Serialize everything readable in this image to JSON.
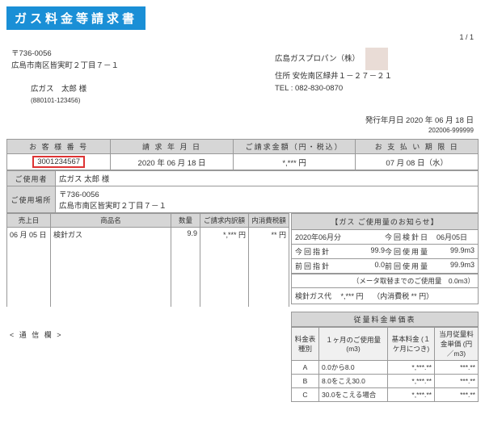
{
  "title": "ガス料金等請求書",
  "page": "1 / 1",
  "postal": "〒736-0056",
  "address": "広島市南区皆実町２丁目７－１",
  "recipient": "広ガス　太郎 様",
  "recipient_id": "(880101-123456)",
  "company": "広島ガスプロパン（株）",
  "company_addr": "住所 安佐南区緑井１－２７－２１",
  "company_tel": "TEL : 082-830-0870",
  "issue_label": "発行年月日",
  "issue_date": "2020 年 06 月 18 日",
  "issue_code": "202006-999999",
  "bar": {
    "h_custno": "お 客 様 番 号",
    "h_billdate": "請 求 年 月 日",
    "h_amount": "ご請求金額（円・税込）",
    "h_due": "お 支 払 い 期 限 日",
    "custno": "3001234567",
    "billdate": "2020 年 06 月 18 日",
    "amount": "*,*** 円",
    "due": "07 月 08 日（水）"
  },
  "user_label": "ご使用者",
  "user_name": "広ガス 太郎 様",
  "place_label": "ご使用場所",
  "place_postal": "〒736-0056",
  "place_addr": "広島市南区皆実町２丁目７－１",
  "detail": {
    "h_date": "売上日",
    "h_item": "商品名",
    "h_qty": "数量",
    "h_breakdown": "ご請求内訳額",
    "h_tax": "内消費税額",
    "date": "06 月 05 日",
    "item": "検針ガス",
    "qty": "9.9",
    "amt": "*,*** 円",
    "tax": "** 円"
  },
  "usage": {
    "title": "【ガス ご使用量のお知らせ】",
    "month": "2020年06月分",
    "read_label": "今回検針日",
    "read_date": "06月05日",
    "cur_idx_l": "今回指針",
    "cur_idx_v": "99.9",
    "cur_use_l": "今回使用量",
    "cur_use_v": "99.9m3",
    "prev_idx_l": "前回指針",
    "prev_idx_v": "0.0",
    "prev_use_l": "前回使用量",
    "prev_use_v": "99.9m3",
    "meter_note": "（メータ取替までのご使用量　0.0m3）",
    "gas_fee_l": "検針ガス代",
    "gas_fee_v": "*,*** 円",
    "inner_tax_l": "（内消費税",
    "inner_tax_v": "** 円）"
  },
  "comm_label": "< 通 信 欄 >",
  "tariff": {
    "title": "従量料金単価表",
    "h_class": "料金表種別",
    "h_usage": "１ヶ月のご使用量 (m3)",
    "h_base": "基本料金 (１ケ月につき)",
    "h_unit": "当月従量料金単価 (円／m3)",
    "rows": [
      {
        "c": "A",
        "u": "0.0から8.0",
        "b": "*,***.**",
        "p": "***.**"
      },
      {
        "c": "B",
        "u": "8.0をこえ30.0",
        "b": "*,***.**",
        "p": "***.**"
      },
      {
        "c": "C",
        "u": "30.0をこえる場合",
        "b": "*,***.**",
        "p": "***.**"
      }
    ]
  }
}
